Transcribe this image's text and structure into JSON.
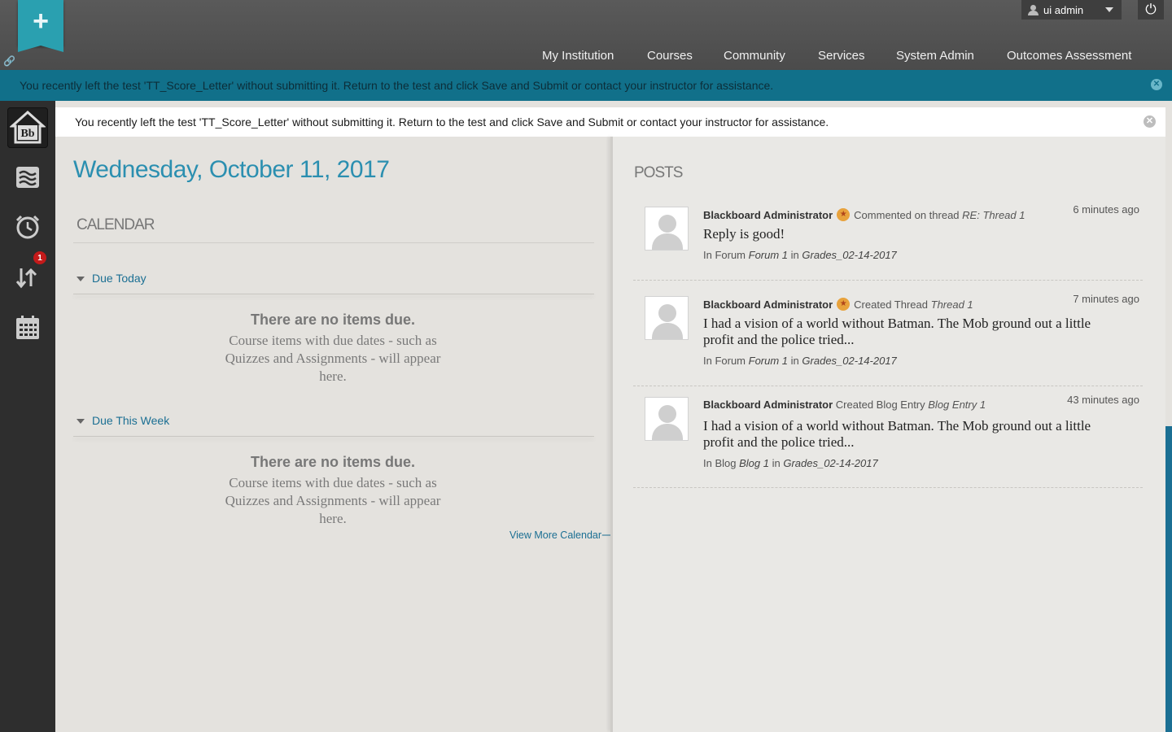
{
  "header": {
    "user_name": "ui admin",
    "nav": [
      "My Institution",
      "Courses",
      "Community",
      "Services",
      "System Admin",
      "Outcomes Assessment"
    ]
  },
  "alerts": {
    "banner": "You recently left the test 'TT_Score_Letter' without submitting it. Return to the test and click Save and Submit or contact your instructor for assistance.",
    "inline": "You recently left the test 'TT_Score_Letter' without submitting it. Return to the test and click Save and Submit or contact your instructor for assistance."
  },
  "rail": {
    "items": [
      "home-icon",
      "stream-icon",
      "alarm-clock-icon",
      "updates-icon",
      "calendar-icon"
    ],
    "updates_badge": "1"
  },
  "calendar": {
    "date": "Wednesday, October 11, 2017",
    "heading": "CALENDAR",
    "due_today": "Due Today",
    "due_week": "Due This Week",
    "empty_title": "There are no items due.",
    "empty_body": "Course items with due dates - such as Quizzes and Assignments - will appear here.",
    "view_more": "View More Calendar⟶"
  },
  "posts": {
    "heading": "POSTS",
    "items": [
      {
        "author": "Blackboard Administrator",
        "has_badge": true,
        "action": "Commented on thread",
        "target": "RE: Thread 1",
        "time": "6 minutes ago",
        "body": "Reply is good!",
        "loc_type": "In Forum",
        "loc_name": "Forum 1",
        "course": "Grades_02-14-2017"
      },
      {
        "author": "Blackboard Administrator",
        "has_badge": true,
        "action": "Created Thread",
        "target": "Thread 1",
        "time": "7 minutes ago",
        "body": "I had a vision of a world without Batman. The Mob ground out a little profit and the police tried...",
        "loc_type": "In Forum",
        "loc_name": "Forum 1",
        "course": "Grades_02-14-2017"
      },
      {
        "author": "Blackboard Administrator",
        "has_badge": false,
        "action": "Created Blog Entry",
        "target": "Blog Entry 1",
        "time": "43 minutes ago",
        "body": "I had a vision of a world without Batman. The Mob ground out a little profit and the police tried...",
        "loc_type": "In Blog",
        "loc_name": "Blog 1",
        "course": "Grades_02-14-2017"
      }
    ],
    "in_word": "in"
  },
  "colors": {
    "accent": "#2b8fb0",
    "alert_bar": "#11708a",
    "link": "#1b6f93",
    "badge": "#c41a1a"
  }
}
